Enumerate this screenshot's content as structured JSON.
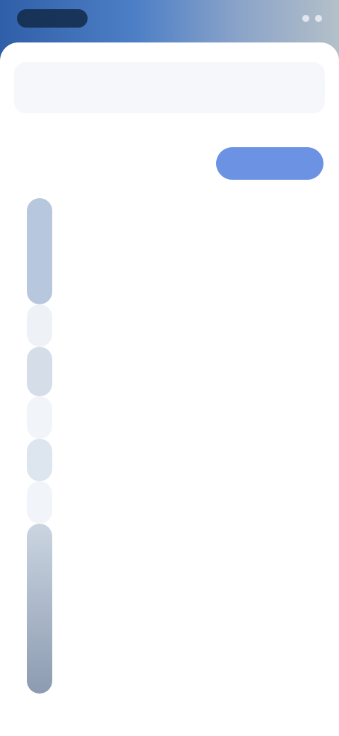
{
  "status_bar": {},
  "header": {
    "left_label": "",
    "right_label": ""
  },
  "section": {
    "title": ""
  },
  "filter": {
    "label": "",
    "value": "",
    "button_label": ""
  },
  "rows": [
    {
      "marker": "",
      "name": "",
      "value": ""
    },
    {
      "marker": "",
      "name": "",
      "value": ""
    },
    {
      "marker": "",
      "name": "",
      "value": ""
    },
    {
      "marker": "",
      "name": "",
      "value": ""
    },
    {
      "marker": "",
      "name": "",
      "value": ""
    },
    {
      "marker": "",
      "name": "",
      "value": ""
    },
    {
      "marker": "",
      "name": "",
      "value": ""
    },
    {
      "marker": "",
      "name": "",
      "value": ""
    },
    {
      "marker": "",
      "name": "",
      "value": ""
    },
    {
      "marker": "",
      "name": "",
      "value": ""
    },
    {
      "marker": "",
      "name": "",
      "value": ""
    },
    {
      "marker": "",
      "name": "",
      "value": ""
    },
    {
      "marker": "",
      "name": "",
      "value": ""
    },
    {
      "marker": "",
      "name": "",
      "value": ""
    },
    {
      "marker": "",
      "name": "",
      "value": ""
    }
  ],
  "colors": {
    "accent": "#6c93e3",
    "wallpaper_start": "#2f5fa8",
    "wallpaper_end": "#b4c0c9",
    "sheet": "#ffffff",
    "text_muted": "#9aa3ad"
  }
}
